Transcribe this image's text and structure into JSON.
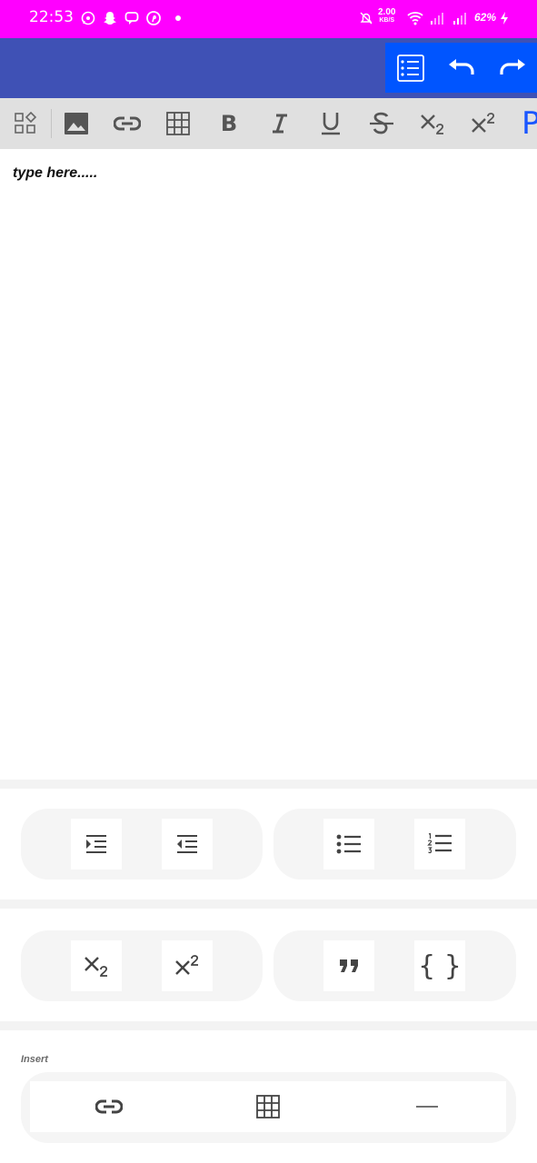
{
  "status_bar": {
    "time": "22:53",
    "notification_icons": [
      "whatsapp-icon",
      "snapchat-icon",
      "chat-bubble-icon",
      "pinterest-icon",
      "dot-icon"
    ],
    "network_speed_value": "2.00",
    "network_speed_unit": "KB/S",
    "battery_percent": "62%",
    "colors": {
      "background": "#ff00ff",
      "text": "#ffffff"
    }
  },
  "app_bar": {
    "color": "#3f51b5",
    "action_group_color": "#0055ff",
    "actions": [
      "checklist-icon",
      "undo-icon",
      "redo-icon"
    ]
  },
  "toolbar": {
    "items": [
      "blocks-icon",
      "image-icon",
      "link-icon",
      "table-icon",
      "bold-icon",
      "italic-icon",
      "underline-icon",
      "strikethrough-icon",
      "subscript-icon",
      "superscript-icon",
      "paragraph-icon"
    ],
    "bold_label": "B",
    "italic_label": "I",
    "paragraph_label": "P",
    "background": "#e0e0e0"
  },
  "editor": {
    "placeholder": "type here....."
  },
  "panels": {
    "row1_left": [
      "indent-icon",
      "outdent-icon"
    ],
    "row1_right": [
      "bullet-list-icon",
      "numbered-list-icon"
    ],
    "row2_left": [
      "subscript-icon",
      "superscript-icon"
    ],
    "row2_right": [
      "quote-icon",
      "code-block-icon"
    ],
    "code_block_label": "{ }"
  },
  "insert": {
    "label": "Insert",
    "items": [
      "link-icon",
      "table-icon",
      "horizontal-rule-icon"
    ]
  }
}
